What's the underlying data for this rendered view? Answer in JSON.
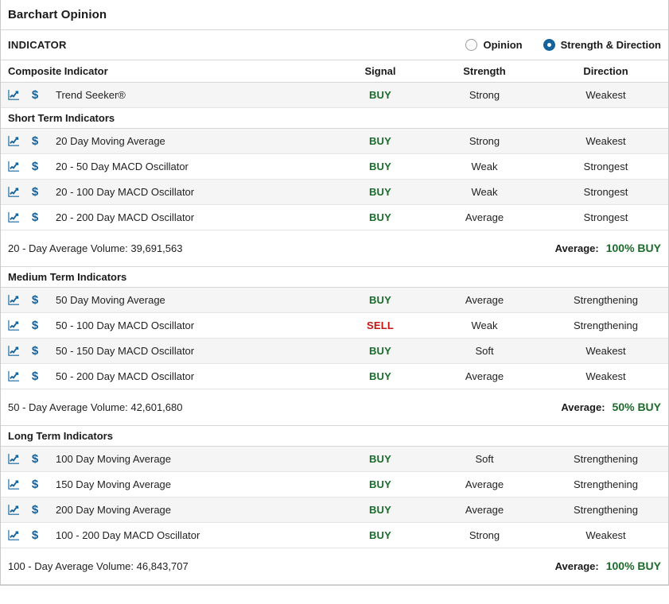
{
  "panel": {
    "title": "Barchart Opinion",
    "indicator_label": "INDICATOR"
  },
  "view_toggle": {
    "options": [
      {
        "label": "Opinion",
        "selected": false
      },
      {
        "label": "Strength & Direction",
        "selected": true
      }
    ]
  },
  "columns": {
    "name": "Composite Indicator",
    "signal": "Signal",
    "strength": "Strength",
    "direction": "Direction"
  },
  "icons": {
    "chart": "line-chart-icon",
    "quote": "dollar-sign-icon"
  },
  "colors": {
    "buy": "#1b6b2b",
    "sell": "#c41414",
    "accent": "#14639b",
    "row_shaded": "#f5f5f5",
    "border": "#d6d6d6"
  },
  "composite": {
    "rows": [
      {
        "name": "Trend Seeker®",
        "signal": "BUY",
        "signal_type": "buy",
        "strength": "Strong",
        "direction": "Weakest"
      }
    ]
  },
  "sections": [
    {
      "heading": "Short Term Indicators",
      "rows": [
        {
          "name": "20 Day Moving Average",
          "signal": "BUY",
          "signal_type": "buy",
          "strength": "Strong",
          "direction": "Weakest"
        },
        {
          "name": "20 - 50 Day MACD Oscillator",
          "signal": "BUY",
          "signal_type": "buy",
          "strength": "Weak",
          "direction": "Strongest"
        },
        {
          "name": "20 - 100 Day MACD Oscillator",
          "signal": "BUY",
          "signal_type": "buy",
          "strength": "Weak",
          "direction": "Strongest"
        },
        {
          "name": "20 - 200 Day MACD Oscillator",
          "signal": "BUY",
          "signal_type": "buy",
          "strength": "Average",
          "direction": "Strongest"
        }
      ],
      "summary": {
        "volume_text": "20 - Day Average Volume: 39,691,563",
        "average_label": "Average:",
        "average_value": "100% BUY",
        "average_type": "buy"
      }
    },
    {
      "heading": "Medium Term Indicators",
      "rows": [
        {
          "name": "50 Day Moving Average",
          "signal": "BUY",
          "signal_type": "buy",
          "strength": "Average",
          "direction": "Strengthening"
        },
        {
          "name": "50 - 100 Day MACD Oscillator",
          "signal": "SELL",
          "signal_type": "sell",
          "strength": "Weak",
          "direction": "Strengthening"
        },
        {
          "name": "50 - 150 Day MACD Oscillator",
          "signal": "BUY",
          "signal_type": "buy",
          "strength": "Soft",
          "direction": "Weakest"
        },
        {
          "name": "50 - 200 Day MACD Oscillator",
          "signal": "BUY",
          "signal_type": "buy",
          "strength": "Average",
          "direction": "Weakest"
        }
      ],
      "summary": {
        "volume_text": "50 - Day Average Volume: 42,601,680",
        "average_label": "Average:",
        "average_value": "50% BUY",
        "average_type": "buy"
      }
    },
    {
      "heading": "Long Term Indicators",
      "rows": [
        {
          "name": "100 Day Moving Average",
          "signal": "BUY",
          "signal_type": "buy",
          "strength": "Soft",
          "direction": "Strengthening"
        },
        {
          "name": "150 Day Moving Average",
          "signal": "BUY",
          "signal_type": "buy",
          "strength": "Average",
          "direction": "Strengthening"
        },
        {
          "name": "200 Day Moving Average",
          "signal": "BUY",
          "signal_type": "buy",
          "strength": "Average",
          "direction": "Strengthening"
        },
        {
          "name": "100 - 200 Day MACD Oscillator",
          "signal": "BUY",
          "signal_type": "buy",
          "strength": "Strong",
          "direction": "Weakest"
        }
      ],
      "summary": {
        "volume_text": "100 - Day Average Volume: 46,843,707",
        "average_label": "Average:",
        "average_value": "100% BUY",
        "average_type": "buy"
      }
    }
  ]
}
